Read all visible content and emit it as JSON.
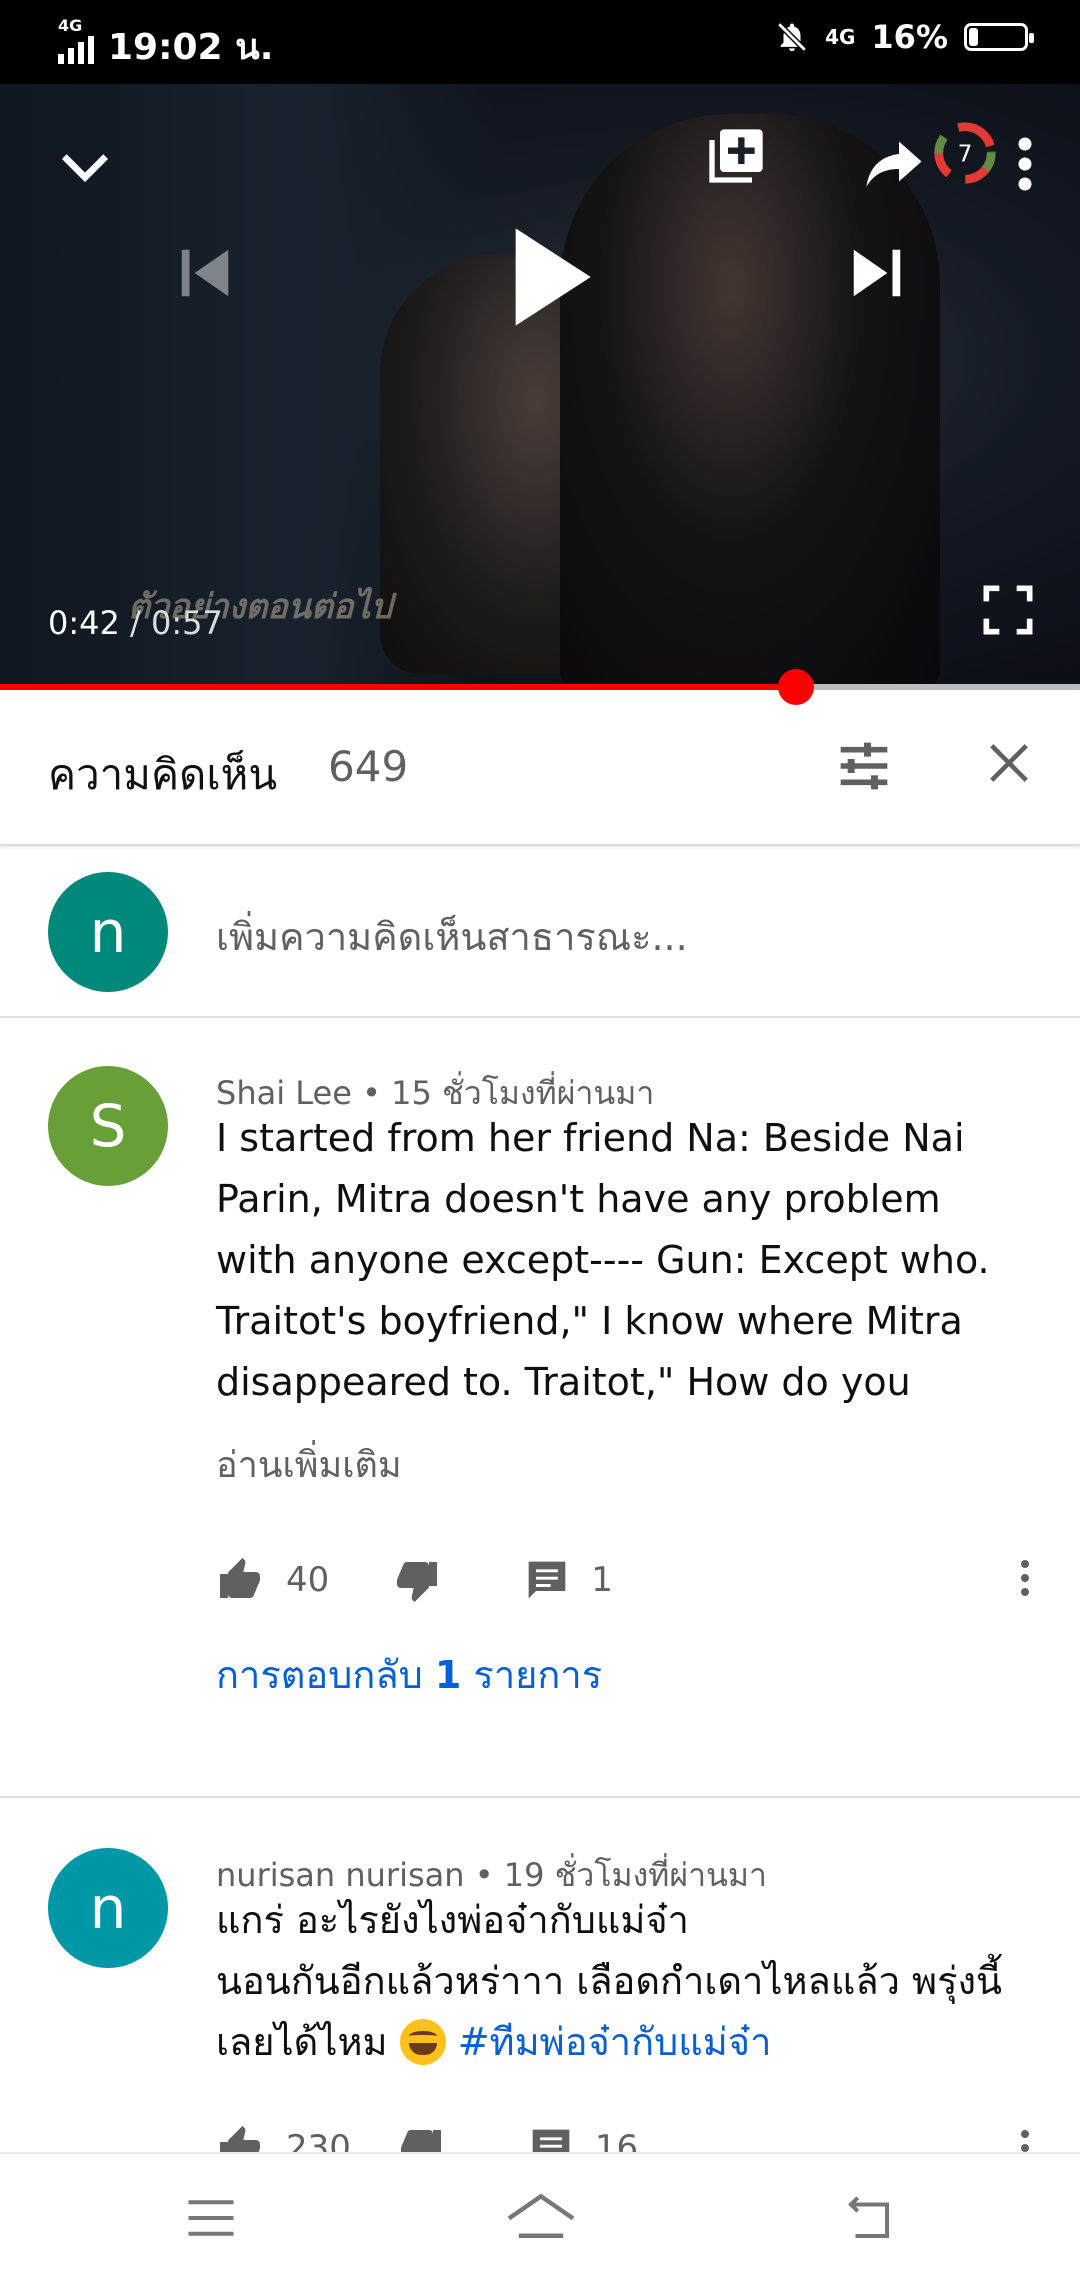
{
  "status_bar": {
    "network_top": "4G",
    "time": "19:02 น.",
    "network_right": "4G",
    "battery": "16%",
    "battery_level": 0.16
  },
  "player": {
    "current_time": "0:42",
    "separator": " / ",
    "duration": "0:57",
    "progress": 0.737,
    "watermark": "ตัวอย่างตอนต่อไป",
    "icons": [
      "chevron-down-icon",
      "add-to-playlist-icon",
      "share-icon",
      "more-vert-icon",
      "previous-icon",
      "play-icon",
      "next-icon",
      "fullscreen-icon"
    ]
  },
  "comments_panel": {
    "title": "ความคิดเห็น",
    "count": "649",
    "compose_avatar": "n",
    "compose_placeholder": "เพิ่มความคิดเห็นสาธารณะ..."
  },
  "comments": [
    {
      "avatar": "S",
      "avatar_color": "#689f38",
      "author": "Shai Lee",
      "time": "15 ชั่วโมงที่ผ่านมา",
      "lines": [
        "I started from her friend Na:  Beside Nai",
        "Parin, Mitra doesn't have any problem",
        "with anyone except---- Gun: Except who.",
        "Traitot's boyfriend,\" I know where Mitra",
        "disappeared to.  Traitot,\" How do you"
      ],
      "read_more": "อ่านเพิ่มเติม",
      "likes": "40",
      "reply_count": "1",
      "replies_prefix": "การตอบกลับ ",
      "replies_number": "1",
      "replies_suffix": " รายการ"
    },
    {
      "avatar": "n",
      "avatar_color": "#0097a7",
      "author": "nurisan nurisan",
      "time": "19 ชั่วโมงที่ผ่านมา",
      "lines": [
        "แกร่ อะไรยังไงพ่อจ๋ากับแม่จ๋า",
        "นอนกันอีกแล้วหร่าาา เลือดกำเดาไหลแล้ว พรุ่งนี้"
      ],
      "line3_text": "เลยได้ไหม ",
      "hashtag": "#ทีมพ่อจ๋ากับแม่จ๋า",
      "likes": "230",
      "reply_count": "16"
    }
  ],
  "nav_bar": [
    "menu-icon",
    "home-icon",
    "back-icon"
  ]
}
